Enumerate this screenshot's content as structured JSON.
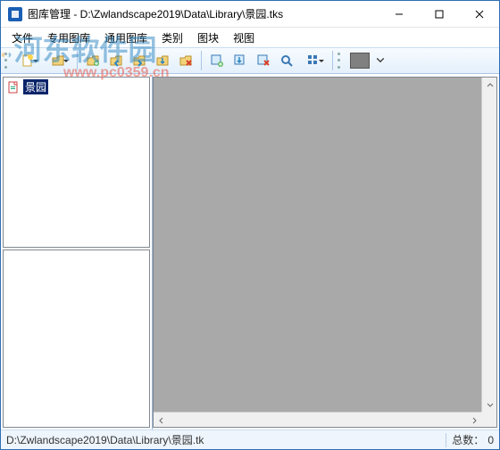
{
  "window": {
    "title": "图库管理 - D:\\Zwlandscape2019\\Data\\Library\\景园.tks"
  },
  "menus": {
    "file": "文件",
    "special_lib": "专用图库",
    "general_lib": "通用图库",
    "category": "类别",
    "block": "图块",
    "view": "视图"
  },
  "tree": {
    "root_label": "景园"
  },
  "status": {
    "path": "D:\\Zwlandscape2019\\Data\\Library\\景园.tk",
    "count_label": "总数：",
    "count_value": "0"
  },
  "colors": {
    "swatch": "#808080"
  },
  "watermark": {
    "brand_text": "河东软件园",
    "url": "www.pc0359.cn"
  }
}
